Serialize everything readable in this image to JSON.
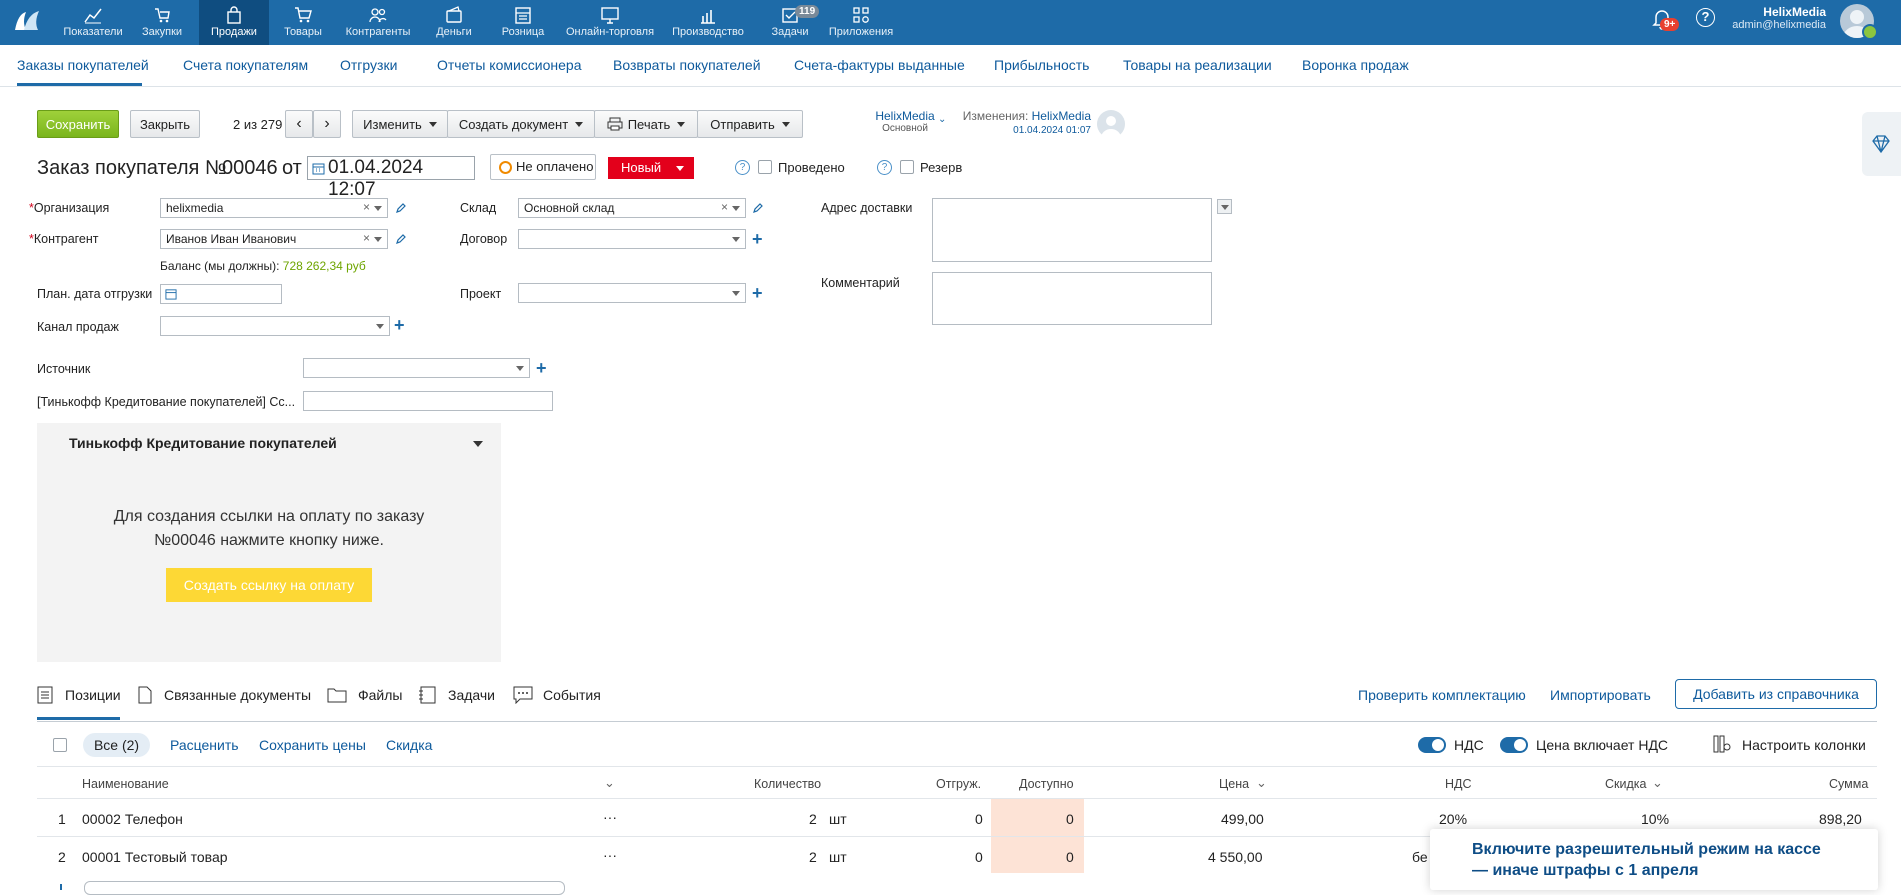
{
  "topnav": {
    "items": [
      {
        "label": "Показатели",
        "icon": "chart-line-icon"
      },
      {
        "label": "Закупки",
        "icon": "cart-arrow-icon"
      },
      {
        "label": "Продажи",
        "icon": "bag-icon"
      },
      {
        "label": "Товары",
        "icon": "cart-icon"
      },
      {
        "label": "Контрагенты",
        "icon": "people-icon"
      },
      {
        "label": "Деньги",
        "icon": "wallet-icon"
      },
      {
        "label": "Розница",
        "icon": "store-icon"
      },
      {
        "label": "Онлайн-торговля",
        "icon": "monitor-icon"
      },
      {
        "label": "Производство",
        "icon": "production-icon"
      },
      {
        "label": "Задачи",
        "icon": "tasks-icon"
      },
      {
        "label": "Приложения",
        "icon": "apps-icon"
      }
    ],
    "tasks_badge": "119",
    "notif_badge": "9+",
    "user_name": "HelixMedia",
    "user_email": "admin@helixmedia"
  },
  "subnav": {
    "tabs": [
      "Заказы покупателей",
      "Счета покупателям",
      "Отгрузки",
      "Отчеты комиссионера",
      "Возвраты покупателей",
      "Счета-фактуры выданные",
      "Прибыльность",
      "Товары на реализации",
      "Воронка продаж"
    ]
  },
  "toolbar": {
    "save": "Сохранить",
    "close": "Закрыть",
    "pager": "2 из 279",
    "edit": "Изменить",
    "create_doc": "Создать документ",
    "print": "Печать",
    "send": "Отправить",
    "owner_name": "HelixMedia",
    "owner_sub": "Основной",
    "changes_label": "Изменения:",
    "changes_user": "HelixMedia",
    "changes_date": "01.04.2024 01:07"
  },
  "order": {
    "title": "Заказ покупателя №",
    "number": "00046",
    "from": "от",
    "date": "01.04.2024 12:07",
    "payment_status": "Не оплачено",
    "state": "Новый",
    "posted_label": "Проведено",
    "reserve_label": "Резерв"
  },
  "form": {
    "org_label": "Организация",
    "org_value": "helixmedia",
    "counterparty_label": "Контрагент",
    "counterparty_value": "Иванов Иван Иванович",
    "balance_label": "Баланс (мы должны):",
    "balance_value": "728 262,34 руб",
    "ship_date_label": "План. дата отгрузки",
    "channel_label": "Канал продаж",
    "warehouse_label": "Склад",
    "warehouse_value": "Основной склад",
    "contract_label": "Договор",
    "project_label": "Проект",
    "address_label": "Адрес доставки",
    "comment_label": "Комментарий",
    "source_label": "Источник",
    "tinkoff_link_label": "[Тинькофф Кредитование покупателей] Сс..."
  },
  "tinkoff": {
    "title": "Тинькофф Кредитование покупателей",
    "line1": "Для создания ссылки на оплату по заказу",
    "line2": "№00046 нажмите кнопку ниже.",
    "button": "Создать ссылку на оплату"
  },
  "tabs": {
    "positions": "Позиции",
    "related": "Связанные документы",
    "files": "Файлы",
    "tasks": "Задачи",
    "events": "События",
    "check": "Проверить комплектацию",
    "import": "Импортировать",
    "add_from_catalog": "Добавить из справочника"
  },
  "filterbar": {
    "all": "Все (2)",
    "reprice": "Расценить",
    "save_prices": "Сохранить цены",
    "discount": "Скидка",
    "vat": "НДС",
    "price_incl_vat": "Цена включает НДС",
    "columns": "Настроить колонки"
  },
  "table": {
    "headers": {
      "name": "Наименование",
      "qty": "Количество",
      "shipped": "Отгруж.",
      "available": "Доступно",
      "price": "Цена",
      "vat": "НДС",
      "discount": "Скидка",
      "sum": "Сумма"
    },
    "rows": [
      {
        "n": "1",
        "name": "00002 Телефон",
        "menu": "···",
        "qty": "2",
        "unit": "шт",
        "shipped": "0",
        "available": "0",
        "price": "499,00",
        "vat": "20%",
        "discount": "10%",
        "sum": "898,20"
      },
      {
        "n": "2",
        "name": "00001 Тестовый товар",
        "menu": "···",
        "qty": "2",
        "unit": "шт",
        "shipped": "0",
        "available": "0",
        "price": "4 550,00",
        "vat": "бе",
        "discount": "",
        "sum": ""
      }
    ]
  },
  "promo": {
    "line1": "Включите разрешительный режим на кассе",
    "line2": "— иначе штрафы с 1 апреля"
  }
}
